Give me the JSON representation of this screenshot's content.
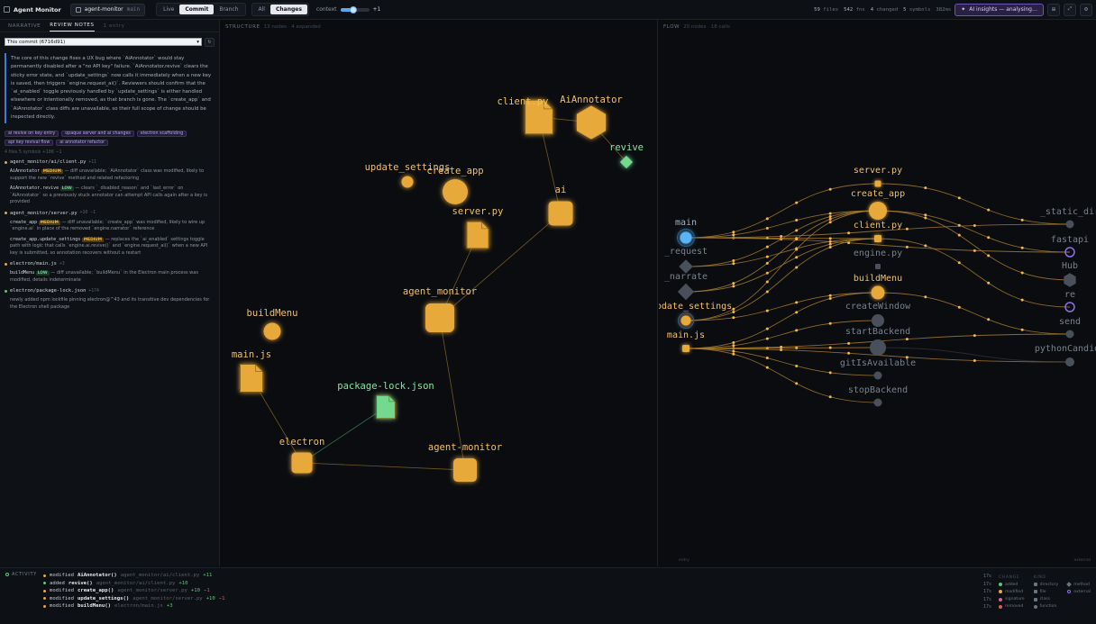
{
  "app": {
    "title": "Agent Monitor"
  },
  "project": {
    "name": "agent-monitor",
    "branch": "main"
  },
  "modes": [
    "Live",
    "Commit",
    "Branch"
  ],
  "active_mode": "Commit",
  "filters": [
    "All",
    "Changes"
  ],
  "active_filter": "Changes",
  "context": {
    "label": "context",
    "value": "+1",
    "level": 0.45
  },
  "stats": [
    {
      "n": "59",
      "l": "files"
    },
    {
      "n": "542",
      "l": "fns"
    },
    {
      "n": "4",
      "l": "changed"
    },
    {
      "n": "5",
      "l": "symbols"
    },
    {
      "n": "",
      "l": "382ms"
    }
  ],
  "insights_label": "AI insights — analysing…",
  "toolbar_icons": [
    "layout-icon",
    "expand-icon",
    "settings-icon"
  ],
  "left": {
    "tabs": [
      "NARRATIVE",
      "REVIEW NOTES"
    ],
    "active_tab": "REVIEW NOTES",
    "entry_count": "1 entry",
    "commit_select": "This commit (6716d91)",
    "summary": "The core of this change fixes a UX bug where `AiAnnotator` would stay permanently disabled after a \"no API key\" failure. `AiAnnotator.revive` clears the sticky error state, and `update_settings` now calls it immediately when a new key is saved, then triggers `engine.request_ai()`. Reviewers should confirm that the `ai_enabled` toggle previously handled by `update_settings` is either handled elsewhere or intentionally removed, as that branch is gone. The `create_app` and `AiAnnotator` class diffs are unavailable, so their full scope of change should be inspected directly.",
    "tags": [
      "ai revive on key entry",
      "opaque server and ai changes",
      "electron scaffolding",
      "api key revival flow",
      "ai annotator refactor"
    ],
    "file_count": "4 files  5 symbols  +186 −1",
    "files": [
      {
        "path": "agent_monitor/ai/client.py",
        "delta": "+11",
        "status": "modified",
        "symbols": [
          {
            "name": "AiAnnotator",
            "level": "MEDIUM",
            "lvl": "m",
            "text": " — diff unavailable; `AiAnnotator` class was modified, likely to support the new `revive` method and related refactoring"
          },
          {
            "name": "AiAnnotator.revive",
            "level": "LOW",
            "lvl": "l",
            "text": " — clears `_disabled_reason` and `last_error` on `AiAnnotator` so a previously stuck annotator can attempt API calls again after a key is provided"
          }
        ]
      },
      {
        "path": "agent_monitor/server.py",
        "delta": "+10 −1",
        "status": "modified",
        "symbols": [
          {
            "name": "create_app",
            "level": "MEDIUM",
            "lvl": "m",
            "text": " — diff unavailable; `create_app` was modified, likely to wire up `engine.ai` in place of the removed `engine.narrator` reference"
          },
          {
            "name": "create_app.update_settings",
            "level": "MEDIUM",
            "lvl": "m",
            "text": " — replaces the `ai_enabled` settings toggle path with logic that calls `engine.ai.revive()` and `engine.request_ai()` when a new API key is submitted, so annotation recovers without a restart"
          }
        ]
      },
      {
        "path": "electron/main.js",
        "delta": "+3",
        "status": "modified",
        "symbols": [
          {
            "name": "buildMenu",
            "level": "LOW",
            "lvl": "l",
            "text": " — diff unavailable; `buildMenu` in the Electron main process was modified, details indeterminate"
          }
        ]
      },
      {
        "path": "electron/package-lock.json",
        "delta": "+174",
        "status": "added",
        "symbols": [
          {
            "name": "",
            "level": "",
            "lvl": "",
            "text": "newly added npm lockfile pinning electron@^43 and its transitive dev dependencies for the Electron shell package"
          }
        ]
      }
    ]
  },
  "structure": {
    "title": "STRUCTURE",
    "sub": "13 nodes · 4 expanded",
    "nodes": [
      {
        "id": "client_py",
        "label": "client.py",
        "kind": "file",
        "status": "modified"
      },
      {
        "id": "aiannotator",
        "label": "AiAnnotator",
        "kind": "class",
        "status": "modified"
      },
      {
        "id": "revive",
        "label": "revive",
        "kind": "method",
        "status": "added"
      },
      {
        "id": "ai",
        "label": "ai",
        "kind": "directory",
        "status": "modified"
      },
      {
        "id": "update_settings",
        "label": "update_settings",
        "kind": "function",
        "status": "modified"
      },
      {
        "id": "create_app",
        "label": "create_app",
        "kind": "function",
        "status": "modified"
      },
      {
        "id": "server_py",
        "label": "server.py",
        "kind": "file",
        "status": "modified"
      },
      {
        "id": "agent_monitor_dir",
        "label": "agent_monitor",
        "kind": "directory",
        "status": "modified"
      },
      {
        "id": "buildmenu",
        "label": "buildMenu",
        "kind": "function",
        "status": "modified"
      },
      {
        "id": "main_js",
        "label": "main.js",
        "kind": "file",
        "status": "modified"
      },
      {
        "id": "package_lock",
        "label": "package-lock.json",
        "kind": "file",
        "status": "added"
      },
      {
        "id": "electron",
        "label": "electron",
        "kind": "directory",
        "status": "modified"
      },
      {
        "id": "agent_monitor_root",
        "label": "agent-monitor",
        "kind": "directory",
        "status": "modified"
      }
    ]
  },
  "flow": {
    "title": "FLOW",
    "sub": "20 nodes · 18 calls",
    "foot_left": "entry",
    "foot_right": "external",
    "nodes": [
      "main",
      "_request",
      "_narrate",
      "update_settings",
      "main.js",
      "server.py",
      "create_app",
      "client.py",
      "engine.py",
      "buildMenu",
      "createWindow",
      "startBackend",
      "gitIsAvailable",
      "stopBackend",
      "_static_dir",
      "fastapi",
      "Hub",
      "re",
      "send",
      "pythonCandida"
    ]
  },
  "activity": {
    "label": "ACTIVITY",
    "rows": [
      {
        "type": "modified",
        "name": "AiAnnotator()",
        "path": "agent_monitor/ai/client.py",
        "plus": "+11",
        "minus": "",
        "time": "17s"
      },
      {
        "type": "added",
        "name": "revive()",
        "path": "agent_monitor/ai/client.py",
        "plus": "+10",
        "minus": "",
        "time": "17s"
      },
      {
        "type": "modified",
        "name": "create_app()",
        "path": "agent_monitor/server.py",
        "plus": "+10",
        "minus": "−1",
        "time": "17s"
      },
      {
        "type": "modified",
        "name": "update_settings()",
        "path": "agent_monitor/server.py",
        "plus": "+10",
        "minus": "−1",
        "time": "17s"
      },
      {
        "type": "modified",
        "name": "buildMenu()",
        "path": "electron/main.js",
        "plus": "+3",
        "minus": "",
        "time": "17s"
      }
    ]
  },
  "legend": {
    "change_title": "CHANGE",
    "change": [
      {
        "l": "added",
        "c": "#59c97a"
      },
      {
        "l": "modified",
        "c": "#e8a93a"
      },
      {
        "l": "signature",
        "c": "#e25c9a"
      },
      {
        "l": "removed",
        "c": "#e55656"
      }
    ],
    "kind_title": "KIND",
    "kind": [
      "directory",
      "file",
      "class",
      "function"
    ],
    "extra": [
      "method",
      "external"
    ]
  }
}
